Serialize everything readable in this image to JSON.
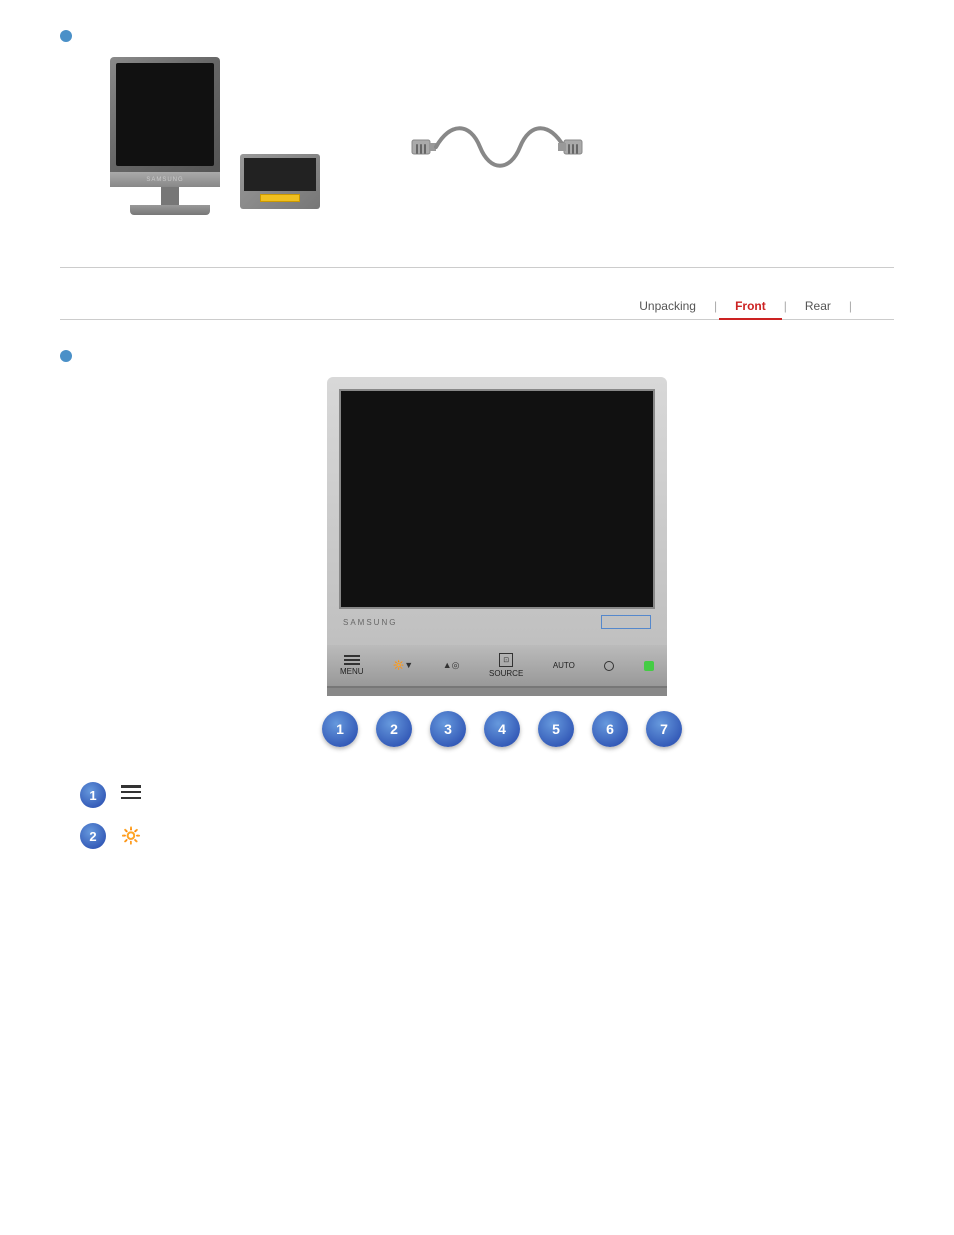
{
  "page": {
    "background": "#ffffff"
  },
  "top": {
    "bullet_color": "#4a90c8"
  },
  "tabs": {
    "items": [
      {
        "label": "Unpacking",
        "active": false
      },
      {
        "label": "Front",
        "active": true
      },
      {
        "label": "Rear",
        "active": false
      }
    ],
    "separator": "|"
  },
  "monitor_front": {
    "brand_text": "SAMSUNG",
    "button_labels": {
      "menu": "MENU",
      "brightness": "🔆▼",
      "volume": "▲◎",
      "source": "SOURCE",
      "source_icon": "⊡",
      "auto": "AUTO",
      "power_icon": "○",
      "indicator": "II"
    }
  },
  "number_buttons": [
    {
      "number": "1"
    },
    {
      "number": "2"
    },
    {
      "number": "3"
    },
    {
      "number": "4"
    },
    {
      "number": "5"
    },
    {
      "number": "6"
    },
    {
      "number": "7"
    }
  ],
  "descriptions": [
    {
      "num": "1",
      "icon_type": "menu",
      "text": ""
    },
    {
      "num": "2",
      "icon_type": "brightness",
      "text": ""
    }
  ]
}
